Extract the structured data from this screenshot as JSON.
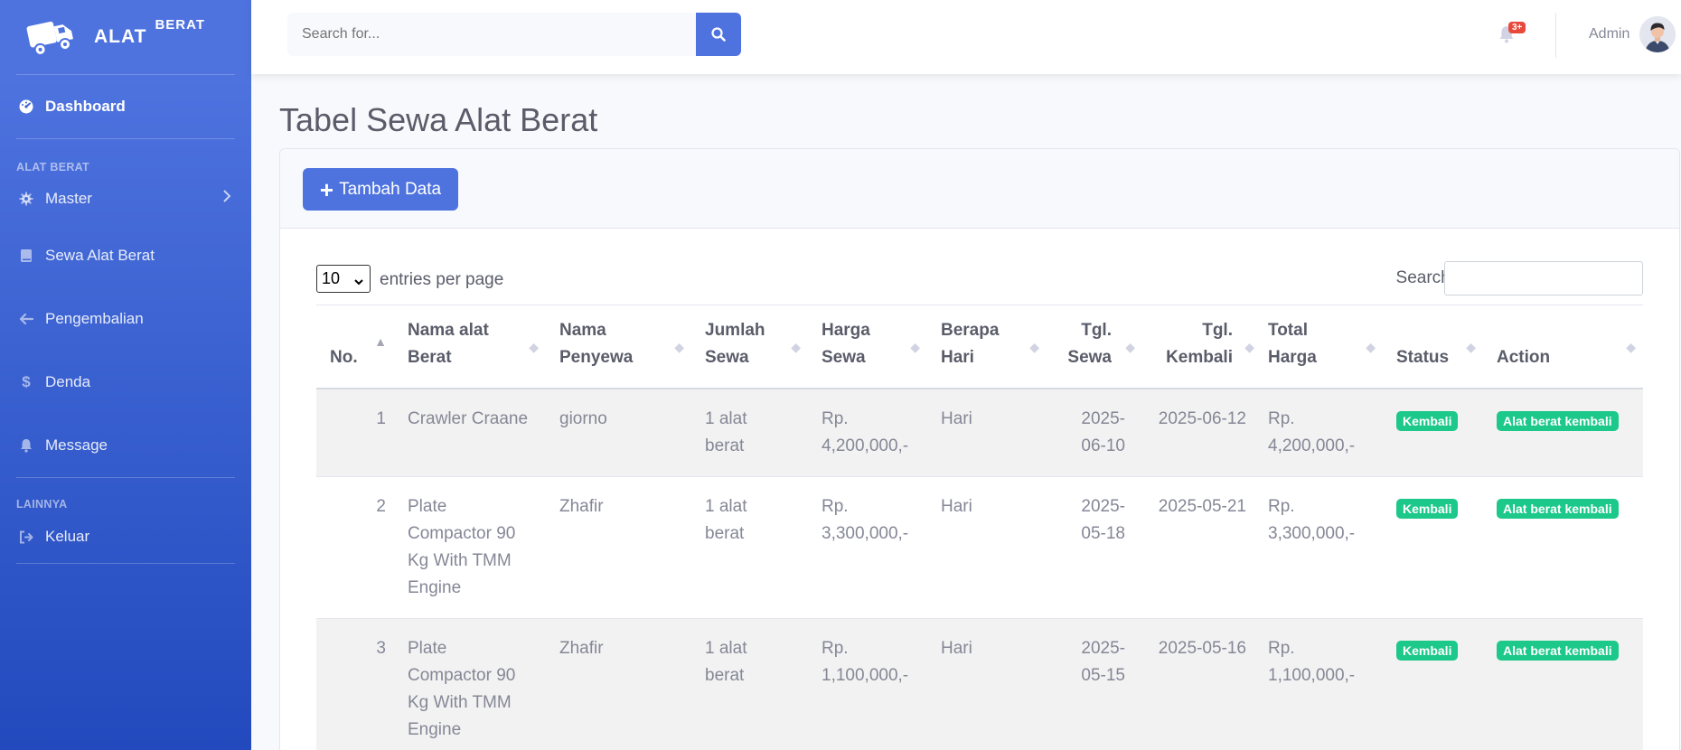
{
  "brand": {
    "name": "ALAT",
    "sup": "BERAT"
  },
  "sidebar": {
    "dashboard": "Dashboard",
    "heading_alat": "ALAT BERAT",
    "master": "Master",
    "sewa": "Sewa Alat Berat",
    "pengembalian": "Pengembalian",
    "denda": "Denda",
    "message": "Message",
    "heading_lainnya": "LAINNYA",
    "keluar": "Keluar"
  },
  "topbar": {
    "search_placeholder": "Search for...",
    "alert_count": "3+",
    "user_name": "Admin"
  },
  "page": {
    "title": "Tabel Sewa Alat Berat",
    "add_button": "Tambah Data",
    "entries_value": "10",
    "entries_label": "entries per page",
    "search_label": "Search:"
  },
  "table": {
    "headers": {
      "no": "No.",
      "nama_alat_1": "Nama alat",
      "nama_alat_2": "Berat",
      "nama_penyewa_1": "Nama",
      "nama_penyewa_2": "Penyewa",
      "jumlah_1": "Jumlah",
      "jumlah_2": "Sewa",
      "harga_1": "Harga",
      "harga_2": "Sewa",
      "hari_1": "Berapa",
      "hari_2": "Hari",
      "tgl_sewa_1": "Tgl.",
      "tgl_sewa_2": "Sewa",
      "tgl_kembali_1": "Tgl.",
      "tgl_kembali_2": "Kembali",
      "total_1": "Total",
      "total_2": "Harga",
      "status": "Status",
      "action": "Action"
    },
    "rows": [
      {
        "no": "1",
        "alat": [
          "Crawler Craane"
        ],
        "penyewa": "giorno",
        "jumlah": [
          "1 alat",
          "berat"
        ],
        "harga": [
          "Rp.",
          "4,200,000,-"
        ],
        "hari": "Hari",
        "tgl_sewa": [
          "2025-",
          "06-10"
        ],
        "tgl_kembali": "2025-06-12",
        "total": [
          "Rp.",
          "4,200,000,-"
        ],
        "status": "Kembali",
        "action": "Alat berat kembali"
      },
      {
        "no": "2",
        "alat": [
          "Plate",
          "Compactor 90",
          "Kg With TMM",
          "Engine"
        ],
        "penyewa": "Zhafir",
        "jumlah": [
          "1 alat",
          "berat"
        ],
        "harga": [
          "Rp.",
          "3,300,000,-"
        ],
        "hari": "Hari",
        "tgl_sewa": [
          "2025-",
          "05-18"
        ],
        "tgl_kembali": "2025-05-21",
        "total": [
          "Rp.",
          "3,300,000,-"
        ],
        "status": "Kembali",
        "action": "Alat berat kembali"
      },
      {
        "no": "3",
        "alat": [
          "Plate",
          "Compactor 90",
          "Kg With TMM",
          "Engine"
        ],
        "penyewa": "Zhafir",
        "jumlah": [
          "1 alat",
          "berat"
        ],
        "harga": [
          "Rp.",
          "1,100,000,-"
        ],
        "hari": "Hari",
        "tgl_sewa": [
          "2025-",
          "05-15"
        ],
        "tgl_kembali": "2025-05-16",
        "total": [
          "Rp.",
          "1,100,000,-"
        ],
        "status": "Kembali",
        "action": "Alat berat kembali"
      }
    ]
  }
}
